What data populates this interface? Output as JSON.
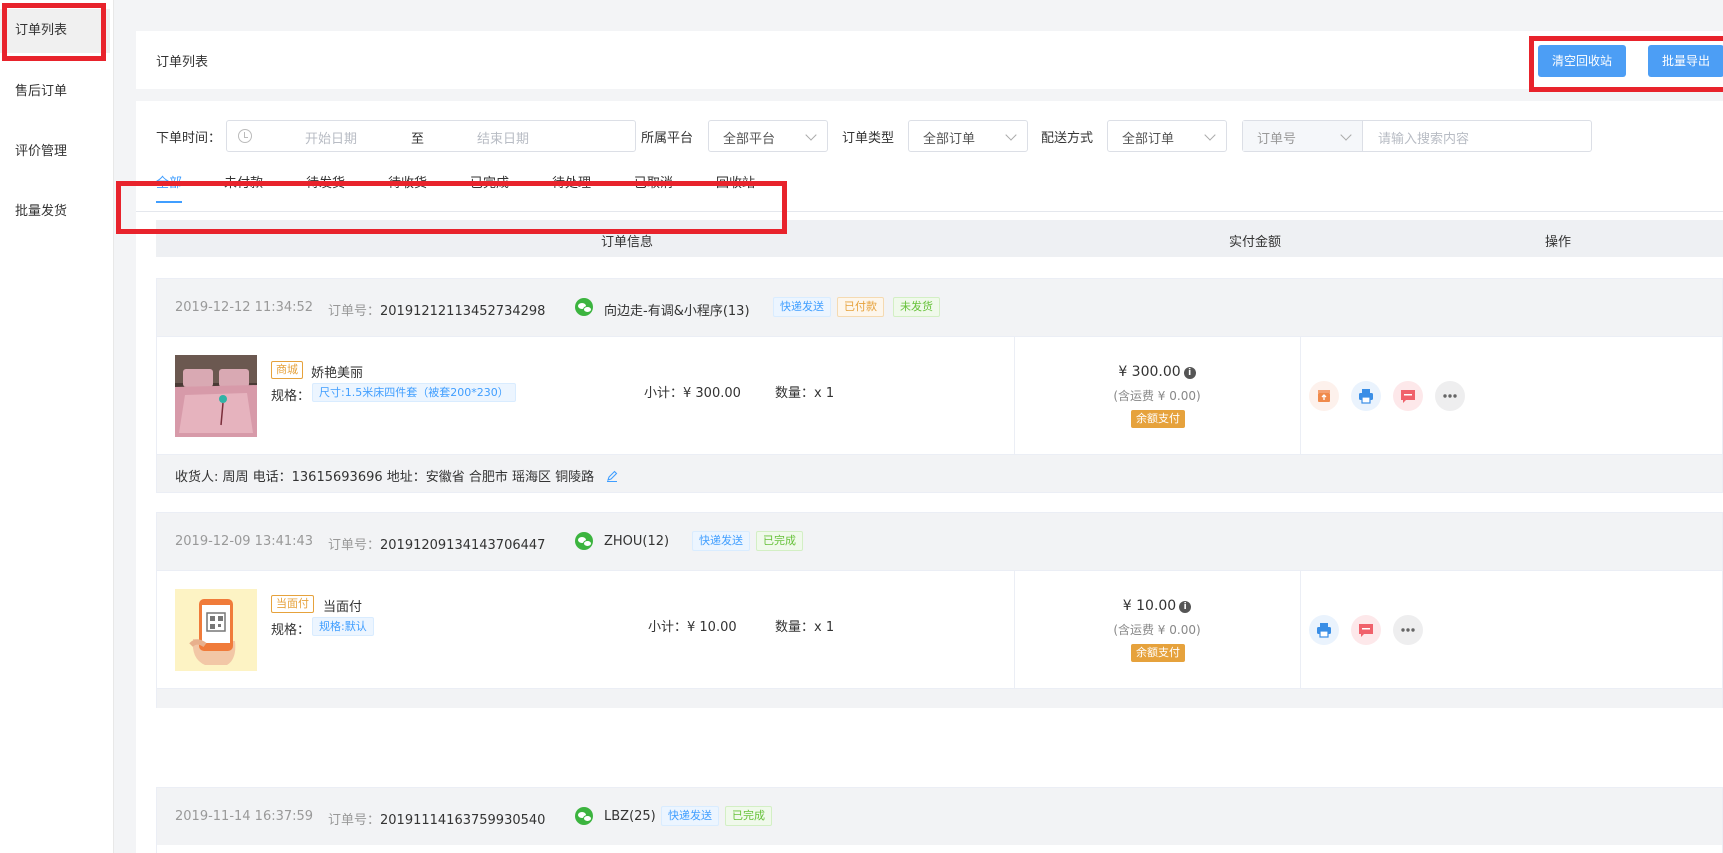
{
  "sidebar": {
    "items": [
      {
        "label": "订单列表"
      },
      {
        "label": "售后订单"
      },
      {
        "label": "评价管理"
      },
      {
        "label": "批量发货"
      }
    ]
  },
  "header": {
    "title": "订单列表",
    "clear_recycle_label": "清空回收站",
    "batch_export_label": "批量导出"
  },
  "filters": {
    "order_time_label": "下单时间：",
    "start_date_placeholder": "开始日期",
    "range_separator": "至",
    "end_date_placeholder": "结束日期",
    "platform_label": "所属平台",
    "platform_value": "全部平台",
    "order_type_label": "订单类型",
    "order_type_value": "全部订单",
    "delivery_label": "配送方式",
    "delivery_value": "全部订单",
    "search_field_value": "订单号",
    "search_placeholder": "请输入搜索内容"
  },
  "tabs": [
    {
      "label": "全部",
      "active": true
    },
    {
      "label": "未付款"
    },
    {
      "label": "待发货"
    },
    {
      "label": "待收货"
    },
    {
      "label": "已完成"
    },
    {
      "label": "待处理"
    },
    {
      "label": "已取消"
    },
    {
      "label": "回收站"
    }
  ],
  "table_header": {
    "order_info": "订单信息",
    "paid_amount": "实付金额",
    "actions": "操作"
  },
  "orders": [
    {
      "time": "2019-12-12 11:34:52",
      "order_no_label": "订单号：",
      "order_no": "20191212113452734298",
      "buyer": "向边走-有调&小程序(13)",
      "tags": [
        "快递发送",
        "已付款",
        "未发货"
      ],
      "goods_tag": "商城",
      "goods_name": "娇艳美丽",
      "spec_label": "规格：",
      "spec_value": "尺寸:1.5米床四件套（被套200*230）",
      "subtotal": "小计：¥ 300.00",
      "qty": "数量：x 1",
      "price": "¥ 300.00",
      "shipping": "(含运费 ¥ 0.00)",
      "pay_method": "余额支付",
      "address": "收货人: 周周 电话：13615693696 地址：安徽省 合肥市 瑶海区 铜陵路"
    },
    {
      "time": "2019-12-09 13:41:43",
      "order_no_label": "订单号：",
      "order_no": "20191209134143706447",
      "buyer": "ZHOU(12)",
      "tags": [
        "快递发送",
        "已完成"
      ],
      "goods_tag": "当面付",
      "goods_name": "当面付",
      "spec_label": "规格：",
      "spec_value": "规格:默认",
      "subtotal": "小计：¥ 10.00",
      "qty": "数量：x 1",
      "price": "¥ 10.00",
      "shipping": "(含运费 ¥ 0.00)",
      "pay_method": "余额支付"
    },
    {
      "time": "2019-11-14 16:37:59",
      "order_no_label": "订单号：",
      "order_no": "20191114163759930540",
      "buyer": "LBZ(25)",
      "tags": [
        "快递发送",
        "已完成"
      ]
    }
  ]
}
